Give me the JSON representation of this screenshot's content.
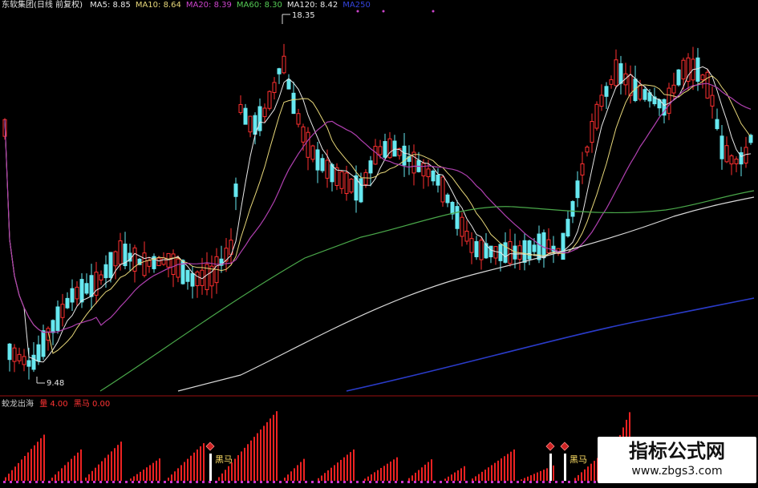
{
  "header": {
    "stock": "东软集团(日线 前复权)",
    "indicators": [
      {
        "label": "MA5: 8.85",
        "color": "#e8e8e8"
      },
      {
        "label": "MA10: 8.64",
        "color": "#e8d87a"
      },
      {
        "label": "MA20: 8.39",
        "color": "#cc44cc"
      },
      {
        "label": "MA60: 8.30",
        "color": "#55cc55"
      },
      {
        "label": "MA120: 8.42",
        "color": "#e8e8e8"
      },
      {
        "label": "MA250",
        "color": "#3344dd"
      }
    ]
  },
  "lower_header": {
    "name": "蛟龙出海",
    "val1": "量 4.00",
    "val2": "黑马 0.00",
    "name_color": "#cccccc",
    "val1_color": "#ff3333",
    "val2_color": "#ff3333"
  },
  "watermark": {
    "title": "指标公式网",
    "url": "www.zbgs3.com"
  },
  "colors": {
    "up": "#ff2f2f",
    "down": "#66e8f0",
    "ma5": "#e8e8e8",
    "ma10": "#e8d87a",
    "ma20": "#b040b0",
    "ma60": "#4aa84a",
    "ma120": "#d8d8d8",
    "ma250": "#2a3bc8",
    "vol": "#ee2222",
    "divider": "#9a1010"
  },
  "chart_data": {
    "type": "candlestick",
    "annotations": [
      {
        "text": "18.35",
        "type": "max_price"
      },
      {
        "text": "9.48",
        "type": "min_price"
      },
      {
        "text": "黑马",
        "type": "signal_label"
      },
      {
        "text": "黑马",
        "type": "signal_label"
      }
    ],
    "price_range": [
      9.0,
      18.8
    ],
    "indicator_range": [
      0,
      9
    ]
  }
}
